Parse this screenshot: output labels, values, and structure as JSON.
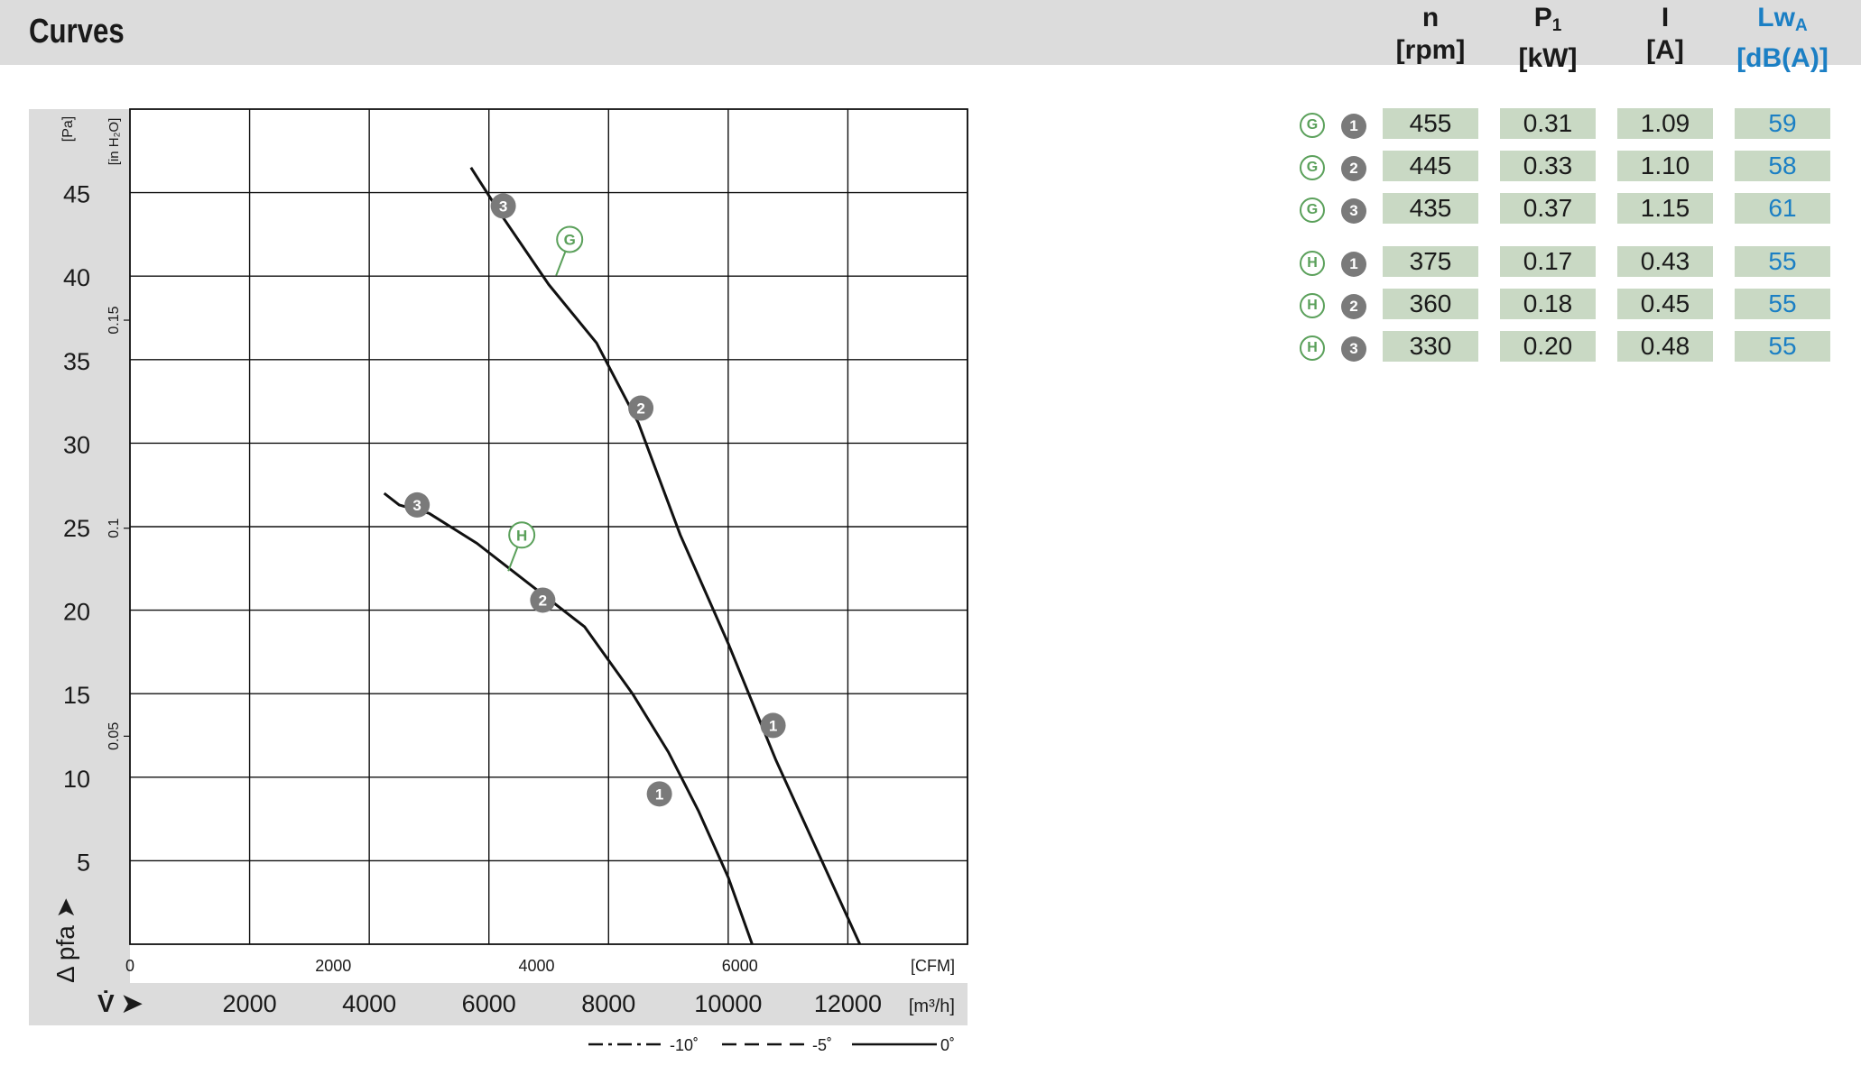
{
  "header": {
    "title": "Curves"
  },
  "table": {
    "columns": [
      {
        "name": "n",
        "sub": "",
        "unit": "[rpm]"
      },
      {
        "name": "P",
        "sub": "1",
        "unit": "[kW]"
      },
      {
        "name": "I",
        "sub": "",
        "unit": "[A]"
      },
      {
        "name": "Lw",
        "sub": "A",
        "unit": "[dB(A)]"
      }
    ],
    "rows": [
      {
        "curve": "G",
        "point": "1",
        "n": "455",
        "p1": "0.31",
        "i": "1.09",
        "lwa": "59"
      },
      {
        "curve": "G",
        "point": "2",
        "n": "445",
        "p1": "0.33",
        "i": "1.10",
        "lwa": "58"
      },
      {
        "curve": "G",
        "point": "3",
        "n": "435",
        "p1": "0.37",
        "i": "1.15",
        "lwa": "61"
      },
      {
        "curve": "H",
        "point": "1",
        "n": "375",
        "p1": "0.17",
        "i": "0.43",
        "lwa": "55"
      },
      {
        "curve": "H",
        "point": "2",
        "n": "360",
        "p1": "0.18",
        "i": "0.45",
        "lwa": "55"
      },
      {
        "curve": "H",
        "point": "3",
        "n": "330",
        "p1": "0.20",
        "i": "0.48",
        "lwa": "55"
      }
    ]
  },
  "chart_data": {
    "type": "line",
    "x_unit_primary": "[m³/h]",
    "x_ticks_primary": [
      2000,
      4000,
      6000,
      8000,
      10000,
      12000
    ],
    "xlim_m3h": [
      0,
      14000
    ],
    "x_unit_secondary": "[CFM]",
    "x_ticks_secondary": [
      0,
      2000,
      4000,
      6000
    ],
    "y_unit_primary": "[Pa]",
    "y_ticks_primary": [
      5,
      10,
      15,
      20,
      25,
      30,
      35,
      40,
      45
    ],
    "ylim_pa": [
      0,
      50
    ],
    "y_unit_secondary": "[in H₂O]",
    "y_ticks_secondary": [
      "0.05",
      "0.1",
      "0.15"
    ],
    "x_axis_symbol": "V̇ ➤",
    "y_axis_symbol": "Δ pfa",
    "grid": true,
    "series": [
      {
        "name": "G",
        "x": [
          5700,
          6200,
          7000,
          7800,
          8500,
          9200,
          10000,
          10800,
          11500,
          12200
        ],
        "y": [
          46.5,
          43.7,
          39.5,
          36,
          31.2,
          24.5,
          18,
          11,
          5.5,
          0
        ],
        "points": [
          {
            "label": "3",
            "x": 6240,
            "y": 44.2
          },
          {
            "label": "2",
            "x": 8540,
            "y": 32.1
          },
          {
            "label": "1",
            "x": 10750,
            "y": 13.1
          }
        ],
        "tag_at": {
          "x": 7350,
          "y": 42.2
        }
      },
      {
        "name": "H",
        "x": [
          4250,
          4500,
          5000,
          5800,
          6700,
          7600,
          8400,
          9000,
          9500,
          10000,
          10400
        ],
        "y": [
          27,
          26.3,
          25.8,
          24,
          21.5,
          19,
          15,
          11.5,
          8,
          4,
          0
        ],
        "points": [
          {
            "label": "3",
            "x": 4800,
            "y": 26.3
          },
          {
            "label": "2",
            "x": 6900,
            "y": 20.6
          },
          {
            "label": "1",
            "x": 8850,
            "y": 9.0
          }
        ],
        "tag_at": {
          "x": 6550,
          "y": 24.5
        }
      }
    ],
    "legend": [
      {
        "label": "-10˚",
        "style": "dash-dot"
      },
      {
        "label": "-5˚",
        "style": "dashed"
      },
      {
        "label": "0˚",
        "style": "solid"
      }
    ]
  },
  "colors": {
    "accent_blue": "#1b7fc4",
    "cell_green": "#c9d9c4",
    "badge_grey": "#7a7a7a",
    "curve_badge_green": "#5aa05a"
  }
}
